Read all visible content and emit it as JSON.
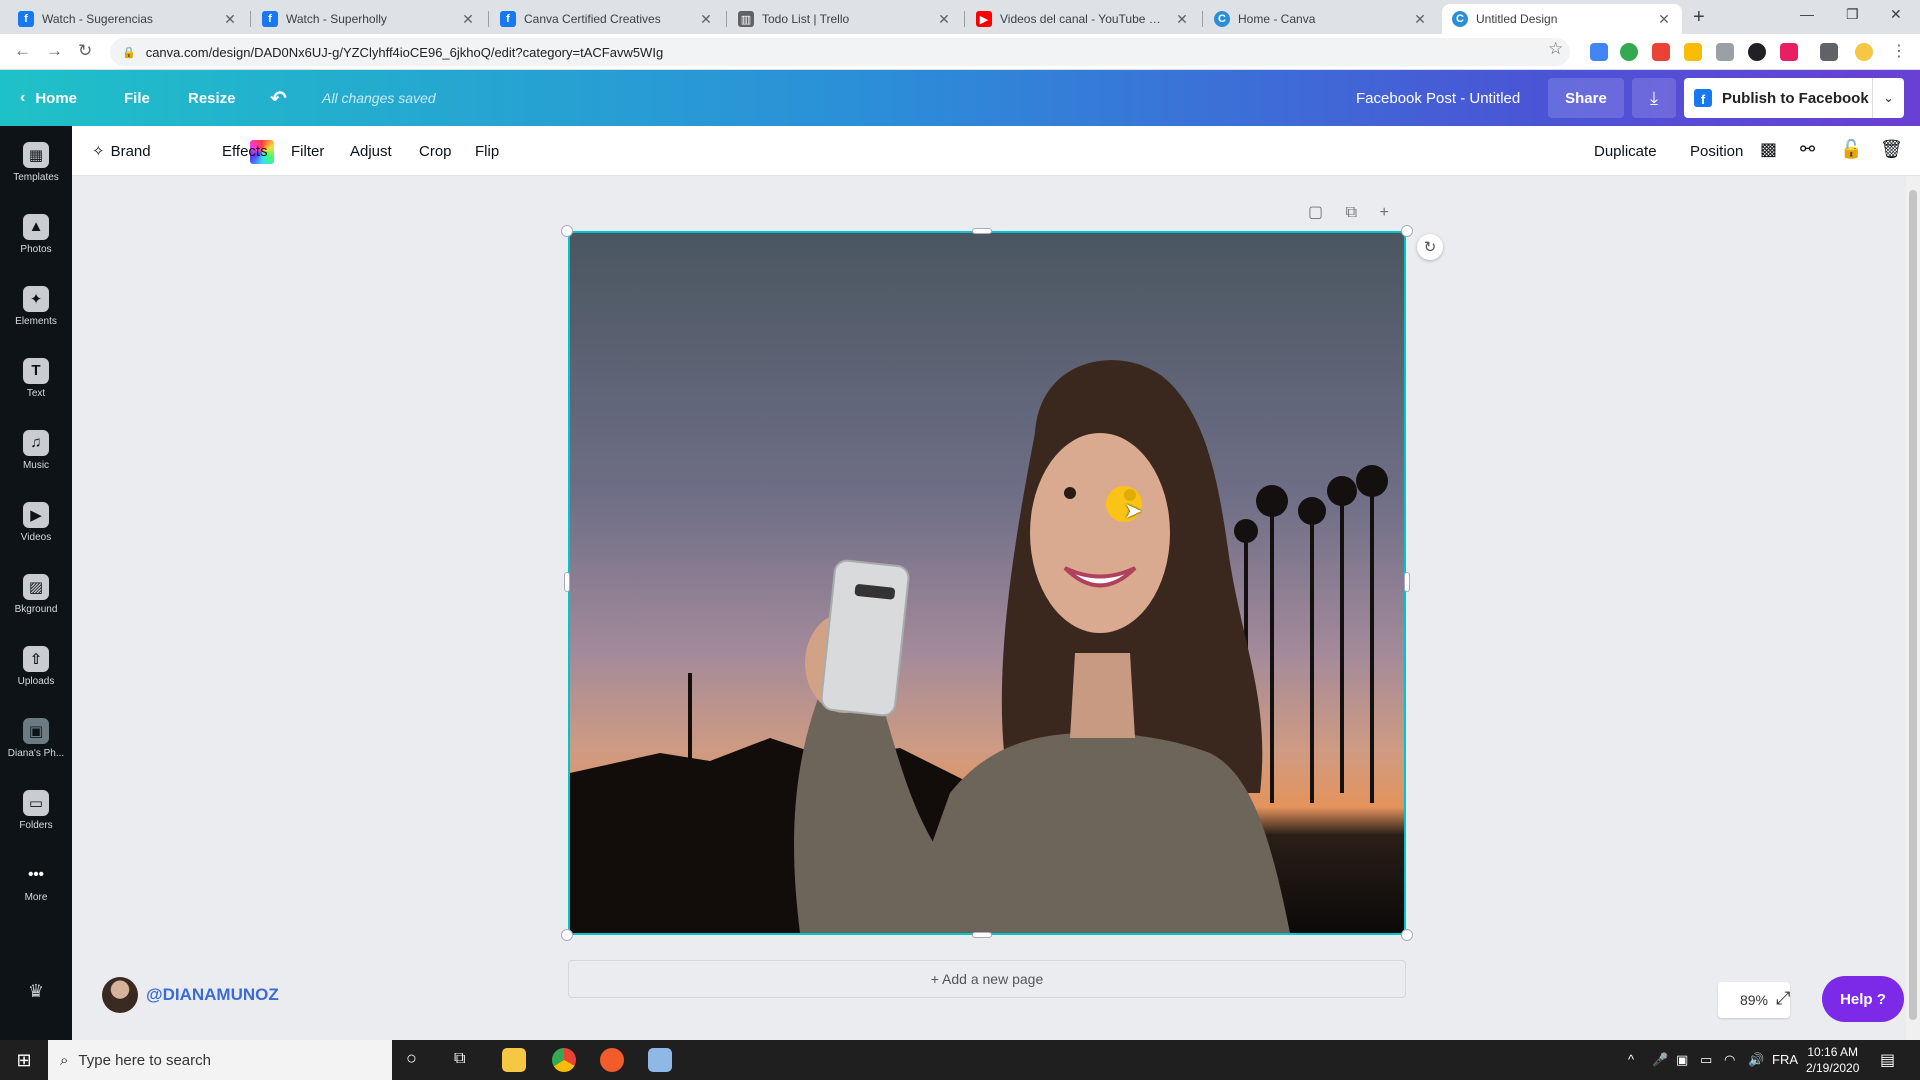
{
  "browser": {
    "tabs": [
      {
        "title": "Watch - Sugerencias",
        "favicon": "facebook-icon",
        "color": "#1877f2",
        "active": false
      },
      {
        "title": "Watch - Superholly",
        "favicon": "facebook-icon",
        "color": "#1877f2",
        "active": false
      },
      {
        "title": "Canva Certified Creatives",
        "favicon": "facebook-icon",
        "color": "#1877f2",
        "active": false
      },
      {
        "title": "Todo List | Trello",
        "favicon": "trello-icon",
        "color": "#5f6368",
        "active": false
      },
      {
        "title": "Videos del canal - YouTube Studi",
        "favicon": "youtube-icon",
        "color": "#ff0000",
        "active": false
      },
      {
        "title": "Home - Canva",
        "favicon": "canva-icon",
        "color": "#2b8fd8",
        "active": false
      },
      {
        "title": "Untitled Design",
        "favicon": "canva-icon",
        "color": "#2b8fd8",
        "active": true
      }
    ],
    "url": "canva.com/design/DAD0Nx6UJ-g/YZClyhff4ioCE96_6jkhoQ/edit?category=tACFavw5WIg"
  },
  "header": {
    "home_label": "Home",
    "file_label": "File",
    "resize_label": "Resize",
    "saved_status": "All changes saved",
    "doc_title": "Facebook Post - Untitled",
    "share_label": "Share",
    "publish_label": "Publish to Facebook"
  },
  "sidebar": {
    "items": [
      {
        "label": "Templates",
        "icon": "templates-icon",
        "glyph": "▦"
      },
      {
        "label": "Photos",
        "icon": "photos-icon",
        "glyph": "▲"
      },
      {
        "label": "Elements",
        "icon": "elements-icon",
        "glyph": "✦"
      },
      {
        "label": "Text",
        "icon": "text-icon",
        "glyph": "T"
      },
      {
        "label": "Music",
        "icon": "music-icon",
        "glyph": "♫"
      },
      {
        "label": "Videos",
        "icon": "videos-icon",
        "glyph": "▶"
      },
      {
        "label": "Bkground",
        "icon": "background-icon",
        "glyph": "▨"
      },
      {
        "label": "Uploads",
        "icon": "uploads-icon",
        "glyph": "⇧"
      },
      {
        "label": "Diana's Ph...",
        "icon": "diana-photos-icon",
        "glyph": "▣"
      },
      {
        "label": "Folders",
        "icon": "folders-icon",
        "glyph": "▭"
      },
      {
        "label": "More",
        "icon": "more-icon",
        "glyph": "•••"
      }
    ]
  },
  "edit_toolbar": {
    "brand_label": "Brand",
    "effects_label": "Effects",
    "filter_label": "Filter",
    "adjust_label": "Adjust",
    "crop_label": "Crop",
    "flip_label": "Flip",
    "duplicate_label": "Duplicate",
    "position_label": "Position"
  },
  "workspace": {
    "add_page_label": "+ Add a new page",
    "zoom_level": "89%",
    "help_label": "Help ?",
    "watermark_handle": "@DIANAMUNOZ"
  },
  "taskbar": {
    "search_placeholder": "Type here to search",
    "language": "FRA",
    "time": "10:16 AM",
    "date": "2/19/2020"
  },
  "colors": {
    "accent": "#00c4cc",
    "header_start": "#1fc1c8",
    "header_end": "#6a3fd4",
    "help": "#7d2ae8",
    "sidebar_bg": "#0e1318"
  }
}
